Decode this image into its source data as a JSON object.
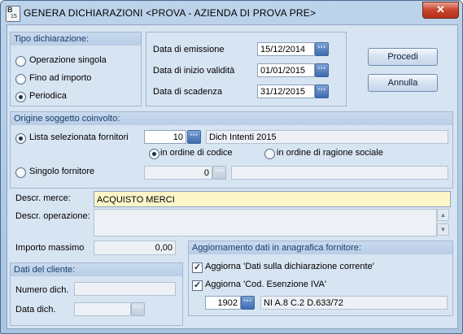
{
  "window": {
    "title": "GENERA DICHIARAZIONI <PROVA - AZIENDA DI PROVA PRE>",
    "close_label": "✕",
    "icon_top": "B",
    "icon_bottom": "15"
  },
  "tipo": {
    "title": "Tipo dichiarazione:",
    "options": [
      {
        "label": "Operazione singola",
        "selected": false
      },
      {
        "label": "Fino ad importo",
        "selected": false
      },
      {
        "label": "Periodica",
        "selected": true
      }
    ]
  },
  "dates": {
    "emissione_label": "Data di emissione",
    "emissione_value": "15/12/2014",
    "inizio_label": "Data di inizio validità",
    "inizio_value": "01/01/2015",
    "scadenza_label": "Data di scadenza",
    "scadenza_value": "31/12/2015",
    "dots": "···"
  },
  "buttons": {
    "procedi": "Procedi",
    "annulla": "Annulla"
  },
  "origine": {
    "title": "Origine soggetto coinvolto:",
    "lista_label": "Lista selezionata fornitori",
    "lista_value": "10",
    "lista_desc": "Dich Intenti 2015",
    "ordine_codice": "in ordine di codice",
    "ordine_ragione": "in ordine di ragione sociale",
    "singolo_label": "Singolo fornitore",
    "singolo_value": "0",
    "singolo_desc": ""
  },
  "merce": {
    "label": "Descr. merce:",
    "value": "ACQUISTO MERCI"
  },
  "operazione": {
    "label": "Descr. operazione:",
    "value": ""
  },
  "importo": {
    "label": "Importo massimo",
    "value": "0,00"
  },
  "cliente": {
    "title": "Dati del cliente:",
    "numero_label": "Numero dich.",
    "numero_value": "",
    "data_label": "Data dich.",
    "data_value": ""
  },
  "aggiornamento": {
    "title": "Aggiornamento dati in anagrafica fornitore:",
    "check1": "Aggiorna 'Dati sulla dichiarazione corrente'",
    "check2": "Aggiorna 'Cod. Esenzione IVA'",
    "codice_value": "1902",
    "codice_desc": "NI A.8 C.2 D.633/72"
  }
}
